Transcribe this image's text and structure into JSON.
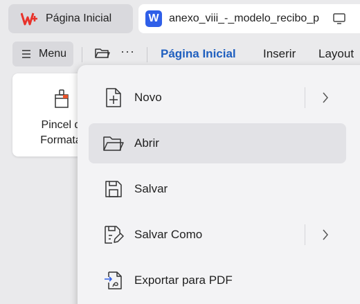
{
  "tabs": {
    "home_label": "Página Inicial",
    "doc_badge": "W",
    "doc_title": "anexo_viii_-_modelo_recibo_p"
  },
  "toolbar": {
    "menu_label": "Menu",
    "more_label": "···",
    "ribbon_tabs": [
      "Página Inicial",
      "Inserir",
      "Layout"
    ]
  },
  "ribbon": {
    "brush_label_line1": "Pincel d",
    "brush_label_line2": "Formata"
  },
  "menu": {
    "items": [
      {
        "label": "Novo",
        "icon": "new-file-icon",
        "submenu": true
      },
      {
        "label": "Abrir",
        "icon": "folder-open-icon",
        "submenu": false
      },
      {
        "label": "Salvar",
        "icon": "save-icon",
        "submenu": false
      },
      {
        "label": "Salvar Como",
        "icon": "save-as-icon",
        "submenu": true
      },
      {
        "label": "Exportar para PDF",
        "icon": "export-pdf-icon",
        "submenu": false
      }
    ]
  },
  "colors": {
    "accent": "#1f5fbf",
    "wps_red": "#e8322a",
    "doc_blue": "#2f5fe8",
    "menu_bg": "#f3f3f5",
    "hover_bg": "#e2e2e6"
  }
}
